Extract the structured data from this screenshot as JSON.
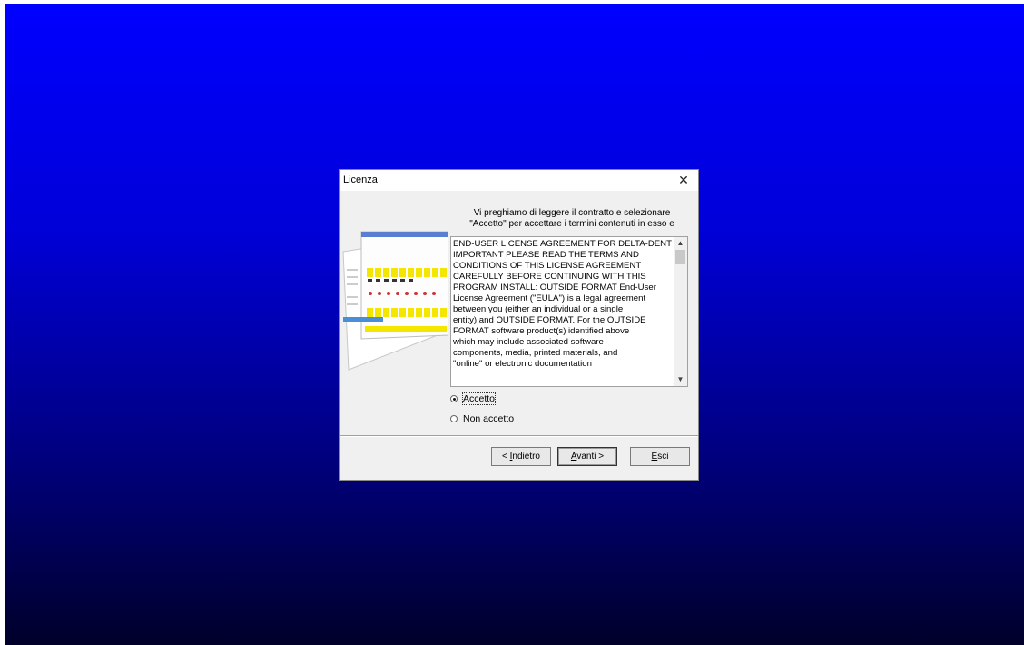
{
  "dialog": {
    "title": "Licenza",
    "close_symbol": "✕",
    "intro_line1": "Vi preghiamo di leggere il contratto e selezionare",
    "intro_line2": "\"Accetto\" per accettare i termini contenuti in esso e",
    "eula_text": "END-USER LICENSE AGREEMENT FOR DELTA-DENT\nIMPORTANT PLEASE READ THE TERMS AND\nCONDITIONS OF THIS LICENSE AGREEMENT\nCAREFULLY BEFORE CONTINUING WITH THIS\nPROGRAM INSTALL: OUTSIDE FORMAT End-User\nLicense Agreement (\"EULA\") is a legal agreement\nbetween you (either an individual or a single\nentity) and OUTSIDE FORMAT. For the OUTSIDE\nFORMAT software product(s) identified above\nwhich may include associated software\ncomponents, media, printed materials, and\n\"online\" or electronic documentation",
    "scroll_up_symbol": "▲",
    "scroll_down_symbol": "▼",
    "radio_accept_label": "Accetto",
    "radio_accept_checked": true,
    "radio_decline_label": "Non accetto",
    "radio_decline_checked": false,
    "back_button_prefix": "< ",
    "back_button_key": "I",
    "back_button_rest": "ndietro",
    "next_button_key": "A",
    "next_button_rest": "vanti >",
    "exit_button_key": "E",
    "exit_button_rest": "sci"
  },
  "colors": {
    "desktop_top": "#0000ff",
    "desktop_bottom": "#00002a",
    "dialog_bg": "#f0f0f0",
    "highlight_yellow": "#f5e600"
  },
  "icons": {
    "close": "close-icon",
    "scroll_up": "chevron-up-icon",
    "scroll_down": "chevron-down-icon",
    "side_image": "software-screenshot-image"
  }
}
